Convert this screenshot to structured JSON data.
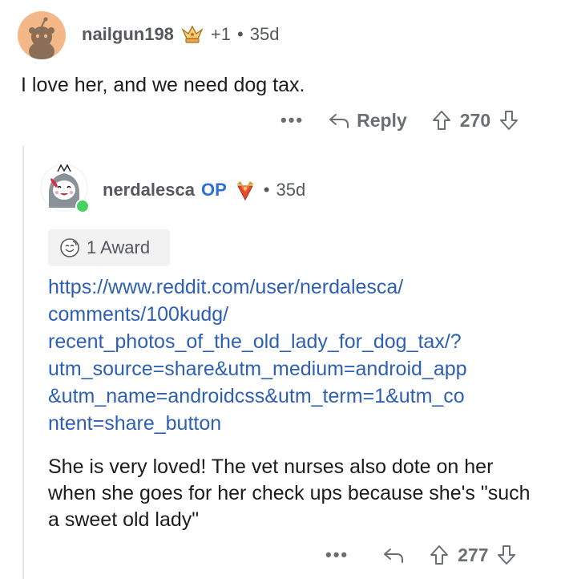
{
  "comment": {
    "username": "nailgun198",
    "award_count": "+1",
    "separator": "•",
    "age": "35d",
    "text": "I love her, and we need dog tax.",
    "more_label": "•••",
    "reply_label": "Reply",
    "score": "270"
  },
  "reply": {
    "username": "nerdalesca",
    "op_badge": "OP",
    "separator": "•",
    "age": "35d",
    "award_label": "1 Award",
    "link": "https://www.reddit.com/user/nerdalesca/\ncomments/100kudg/\nrecent_photos_of_the_old_lady_for_dog_tax/?\nutm_source=share&utm_medium=android_app\n&utm_name=androidcss&utm_term=1&utm_co\nntent=share_button",
    "text": "She is very loved! The vet nurses also dote on her when she goes for her check ups because she's \"such a sweet old lady\"",
    "more_label": "•••",
    "score": "277"
  },
  "colors": {
    "link": "#2d5fb3",
    "op": "#2e6fd6",
    "online": "#46d160",
    "avatar_bg": "#f3b788"
  }
}
